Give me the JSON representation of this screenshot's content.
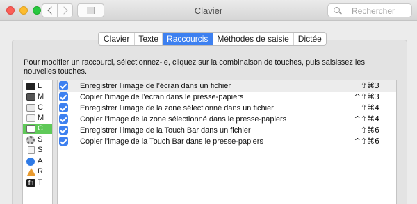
{
  "window": {
    "title": "Clavier"
  },
  "toolbar": {
    "search_placeholder": "Rechercher",
    "icons": {
      "back": "chevron-left-icon",
      "forward": "chevron-right-icon",
      "show_all": "grid-icon",
      "search": "search-icon"
    }
  },
  "tabs": [
    {
      "label": "Clavier",
      "active": false
    },
    {
      "label": "Texte",
      "active": false
    },
    {
      "label": "Raccourcis",
      "active": true
    },
    {
      "label": "Méthodes de saisie",
      "active": false
    },
    {
      "label": "Dictée",
      "active": false
    }
  ],
  "instructions": "Pour modifier un raccourci, sélectionnez-le, cliquez sur la combinaison de touches, puis saisissez les nouvelles touches.",
  "categories": [
    {
      "label": "L",
      "icon": "launchpad-icon",
      "selected": false
    },
    {
      "label": "M",
      "icon": "mission-control-icon",
      "selected": false
    },
    {
      "label": "C",
      "icon": "keyboard-icon",
      "selected": false
    },
    {
      "label": "M",
      "icon": "input-menu-icon",
      "selected": false
    },
    {
      "label": "C",
      "icon": "screenshot-icon",
      "selected": true
    },
    {
      "label": "S",
      "icon": "services-icon",
      "selected": false
    },
    {
      "label": "S",
      "icon": "spotlight-icon",
      "selected": false
    },
    {
      "label": "A",
      "icon": "accessibility-icon",
      "selected": false
    },
    {
      "label": "R",
      "icon": "app-shortcuts-icon",
      "selected": false
    },
    {
      "label": "T",
      "icon": "fn-key-icon",
      "selected": false
    }
  ],
  "shortcuts": [
    {
      "label": "Enregistrer l’image de l’écran dans un fichier",
      "keys": "⇧⌘3",
      "checked": true,
      "highlighted": true
    },
    {
      "label": "Copier l’image de l’écran dans le presse-papiers",
      "keys": "^⇧⌘3",
      "checked": true,
      "highlighted": false
    },
    {
      "label": "Enregistrer l’image de la zone sélectionné dans un fichier",
      "keys": "⇧⌘4",
      "checked": true,
      "highlighted": false
    },
    {
      "label": "Copier l’image de la zone sélectionné dans le presse-papiers",
      "keys": "^⇧⌘4",
      "checked": true,
      "highlighted": false
    },
    {
      "label": "Enregistrer l’image de la Touch Bar dans un fichier",
      "keys": "⇧⌘6",
      "checked": true,
      "highlighted": false
    },
    {
      "label": "Copier l’image de la Touch Bar dans le presse-papiers",
      "keys": "^⇧⌘6",
      "checked": true,
      "highlighted": false
    }
  ],
  "fn_badge": "fn"
}
